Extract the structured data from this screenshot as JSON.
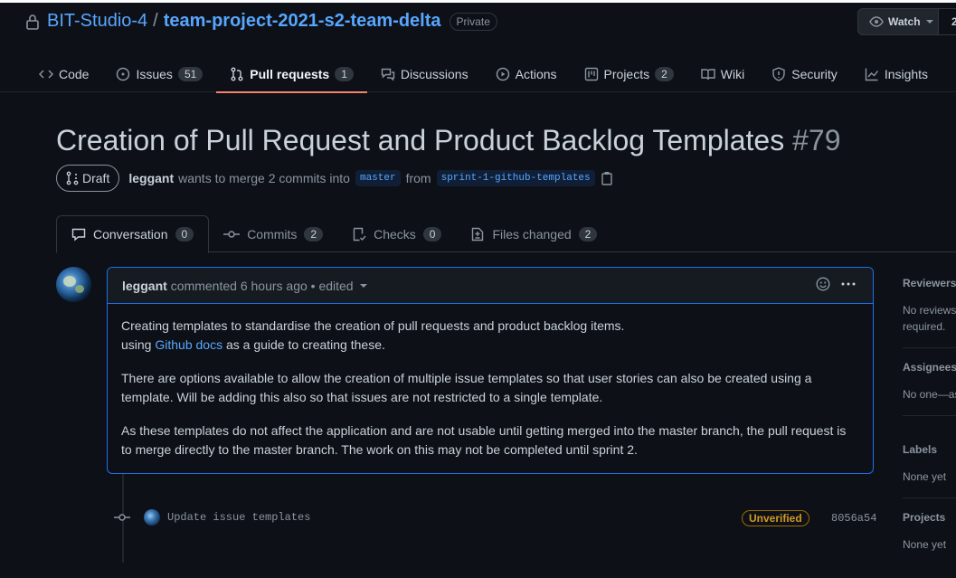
{
  "repo": {
    "owner": "BIT-Studio-4",
    "name": "team-project-2021-s2-team-delta",
    "visibility": "Private"
  },
  "watch": {
    "label": "Watch",
    "count": "2"
  },
  "nav": [
    {
      "label": "Code"
    },
    {
      "label": "Issues",
      "count": "51"
    },
    {
      "label": "Pull requests",
      "count": "1"
    },
    {
      "label": "Discussions"
    },
    {
      "label": "Actions"
    },
    {
      "label": "Projects",
      "count": "2"
    },
    {
      "label": "Wiki"
    },
    {
      "label": "Security"
    },
    {
      "label": "Insights"
    }
  ],
  "pr": {
    "title": "Creation of Pull Request and Product Backlog Templates",
    "number": "#79",
    "status": "Draft",
    "author": "leggant",
    "merge_text": "wants to merge 2 commits into",
    "base": "master",
    "from_text": "from",
    "head": "sprint-1-github-templates"
  },
  "tabs": [
    {
      "label": "Conversation",
      "count": "0"
    },
    {
      "label": "Commits",
      "count": "2"
    },
    {
      "label": "Checks",
      "count": "0"
    },
    {
      "label": "Files changed",
      "count": "2"
    }
  ],
  "comment": {
    "author": "leggant",
    "meta": "commented 6 hours ago • edited",
    "p1a": "Creating templates to standardise the creation of pull requests and product backlog items.",
    "p1b": "using",
    "link": "Github docs",
    "p1c": "as a guide to creating these.",
    "p2": "There are options available to allow the creation of multiple issue templates so that user stories can also be created using a template. Will be adding this also so that issues are not restricted to a single template.",
    "p3": "As these templates do not affect the application and are not usable until getting merged into the master branch, the pull request is to merge directly to the master branch. The work on this may not be completed until sprint 2."
  },
  "commit": {
    "message": "Update issue templates",
    "badge": "Unverified",
    "sha": "8056a54"
  },
  "sidebar": {
    "reviewers": {
      "title": "Reviewers",
      "value": "No reviews",
      "value2": "required."
    },
    "assignees": {
      "title": "Assignees",
      "value": "No one—assign yourself"
    },
    "labels": {
      "title": "Labels",
      "value": "None yet"
    },
    "projects": {
      "title": "Projects",
      "value": "None yet"
    }
  }
}
